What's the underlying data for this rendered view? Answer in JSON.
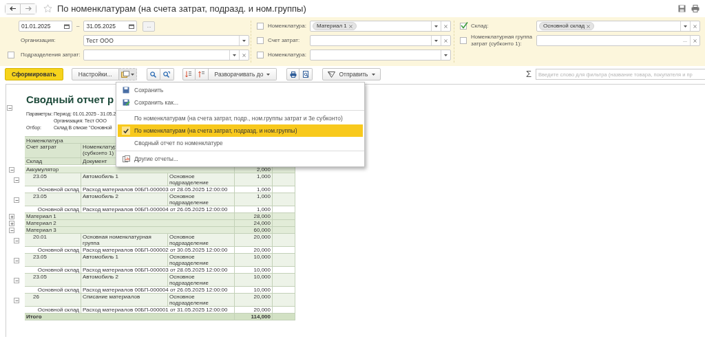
{
  "window": {
    "title": "По номенклатурам (на счета затрат, подразд. и ном.группы)"
  },
  "period": {
    "start": "01.01.2025",
    "separator": "–",
    "end": "31.05.2025",
    "more_button": "..."
  },
  "filter_columns": [
    [
      {
        "label": "Организация:",
        "value": "Тест ООО",
        "buttons": [
          {
            "kind": "dropdown"
          }
        ]
      },
      {
        "label": "Подразделения затрат:",
        "checked": false,
        "buttons": [
          {
            "kind": "dropdown"
          },
          {
            "kind": "clear"
          }
        ]
      }
    ],
    [
      {
        "label": "Номенклатура:",
        "checked": false,
        "tags": [
          "Материал 1"
        ],
        "buttons": [
          {
            "kind": "dropdown"
          },
          {
            "kind": "clear"
          }
        ]
      },
      {
        "label": "Счет затрат:",
        "checked": false,
        "buttons": [
          {
            "kind": "dropdown"
          },
          {
            "kind": "clear"
          }
        ]
      },
      {
        "label": "Номенклатура:",
        "checked": false,
        "buttons": [
          {
            "kind": "dropdown"
          }
        ]
      }
    ],
    [
      {
        "label": "Склад:",
        "checked": true,
        "tags": [
          "Основной склад"
        ],
        "buttons": [
          {
            "kind": "dropdown"
          },
          {
            "kind": "clear"
          }
        ]
      },
      {
        "label": "Номенклатурная группа затрат (субконто 1):",
        "checked": false,
        "buttons": [
          {
            "kind": "select",
            "label": "..."
          },
          {
            "kind": "clear"
          }
        ]
      }
    ]
  ],
  "toolbar": {
    "generate": "Сформировать",
    "settings": "Настройки...",
    "expand": "Разворачивать до",
    "send": "Отправить",
    "sum": "Σ",
    "filter_placeholder": "Введите слово для фильтра (название товара, покупателя и пр"
  },
  "menu": {
    "groups": [
      [
        {
          "kind": "save",
          "label": "Сохранить"
        },
        {
          "kind": "save_as",
          "label": "Сохранить как..."
        }
      ],
      [
        {
          "kind": "variant",
          "label": "По номенклатурам (на счета затрат, подр., ном.группы затрат и 3е субконто)",
          "selected": false
        },
        {
          "kind": "variant",
          "label": "По номенклатурам (на счета затрат, подразд. и ном.группы)",
          "selected": true
        },
        {
          "kind": "variant",
          "label": "Сводный отчет по номенклатуре",
          "selected": false
        }
      ],
      [
        {
          "kind": "reports",
          "label": "Другие отчеты..."
        }
      ]
    ]
  },
  "report": {
    "title": "Сводный отчет р",
    "expanded": true,
    "parameters": [
      {
        "label": "Параметры:",
        "value": "Период: 01.01.2025 - 31.05.2"
      },
      {
        "value": "Организация: Тест ООО"
      },
      {
        "label": "Отбор:",
        "value": "Склад В списке \"Основной"
      }
    ],
    "header": {
      "group": "Номенклатура",
      "account": "Счет затрат",
      "item": "Номенклатур\n(субконто 1)",
      "warehouse": "Склад",
      "document": "Документ"
    },
    "rows": [
      {
        "name": "Аккумулятор",
        "amount": "2,000",
        "expanded": true,
        "children": [
          {
            "account": "23.05",
            "item": "Автомобиль 1",
            "department": "Основное подразделение",
            "amount": "1,000",
            "expanded": true,
            "children": [
              {
                "warehouse": "Основной склад",
                "document": "Расход материалов 00БП-000003 от 28.05.2025 12:00:00",
                "amount": "1,000"
              }
            ]
          },
          {
            "account": "23.05",
            "item": "Автомобиль 2",
            "department": "Основное подразделение",
            "amount": "1,000",
            "expanded": true,
            "children": [
              {
                "warehouse": "Основной склад",
                "document": "Расход материалов 00БП-000004 от 26.05.2025 12:00:00",
                "amount": "1,000"
              }
            ]
          }
        ]
      },
      {
        "name": "Материал 1",
        "amount": "28,000",
        "expanded": false
      },
      {
        "name": "Материал 2",
        "amount": "24,000",
        "expanded": false
      },
      {
        "name": "Материал 3",
        "amount": "60,000",
        "expanded": true,
        "children": [
          {
            "account": "20.01",
            "item": "Основная номенклатурная группа",
            "department": "Основное подразделение",
            "amount": "20,000",
            "expanded": true,
            "children": [
              {
                "warehouse": "Основной склад",
                "document": "Расход материалов 00БП-000002 от 30.05.2025 12:00:00",
                "amount": "20,000"
              }
            ]
          },
          {
            "account": "23.05",
            "item": "Автомобиль 1",
            "department": "Основное подразделение",
            "amount": "10,000",
            "expanded": true,
            "children": [
              {
                "warehouse": "Основной склад",
                "document": "Расход материалов 00БП-000003 от 28.05.2025 12:00:00",
                "amount": "10,000"
              }
            ]
          },
          {
            "account": "23.05",
            "item": "Автомобиль 2",
            "department": "Основное подразделение",
            "amount": "10,000",
            "expanded": true,
            "children": [
              {
                "warehouse": "Основной склад",
                "document": "Расход материалов 00БП-000004 от 26.05.2025 12:00:00",
                "amount": "10,000"
              }
            ]
          },
          {
            "account": "26",
            "item": "Списание материалов",
            "department": "Основное подразделение",
            "amount": "20,000",
            "expanded": true,
            "children": [
              {
                "warehouse": "Основной склад",
                "document": "Расход материалов 00БП-000001 от 31.05.2025 12:00:00",
                "amount": "20,000"
              }
            ]
          }
        ]
      }
    ],
    "total": {
      "label": "Итого",
      "amount": "114,000"
    }
  }
}
